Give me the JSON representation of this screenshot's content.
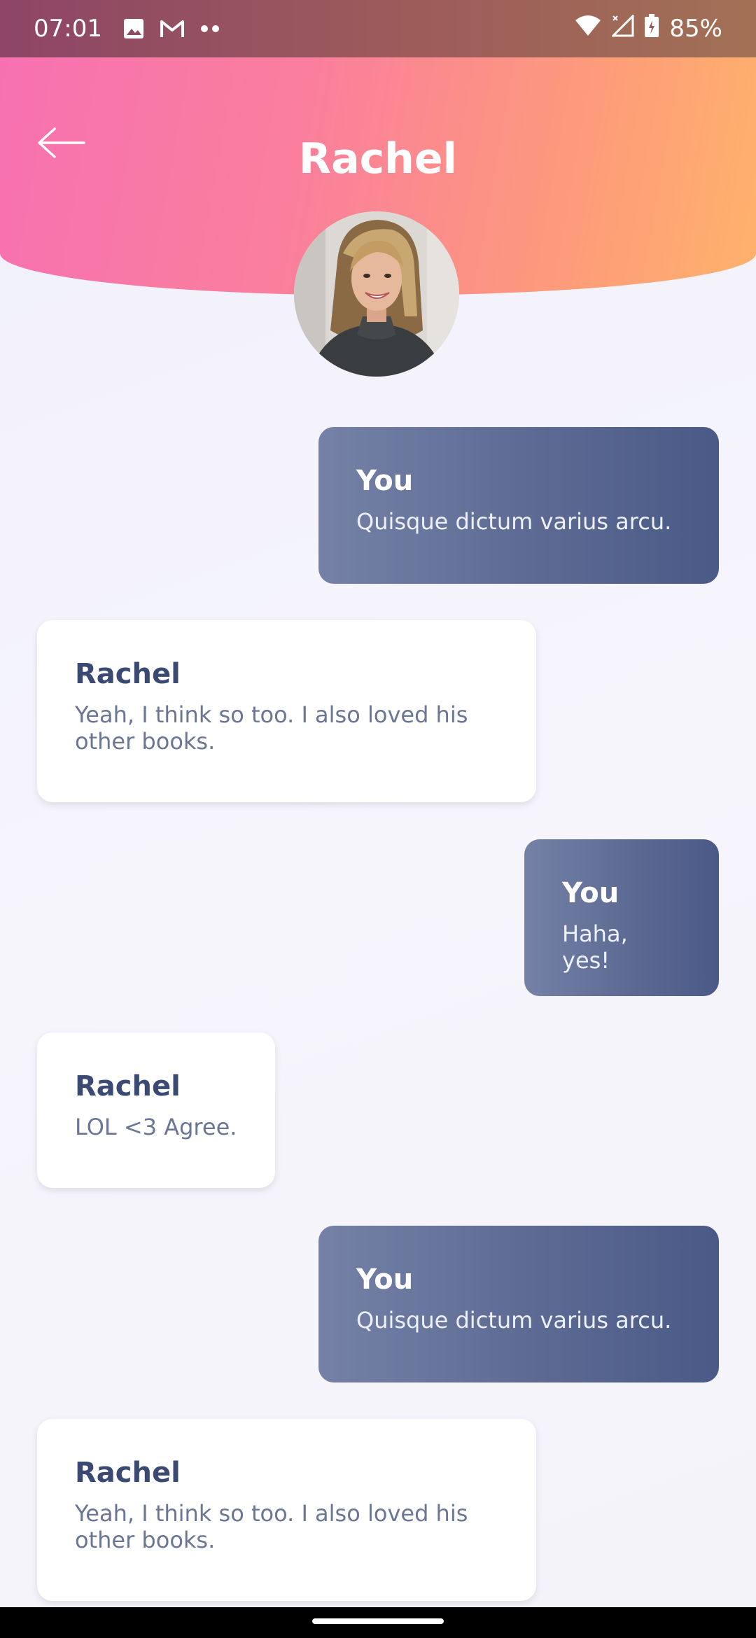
{
  "status_bar": {
    "time": "07:01",
    "battery": "85%",
    "icons": [
      "image-icon",
      "gmail-icon",
      "more-dots-icon",
      "wifi-icon",
      "signal-icon",
      "battery-icon"
    ]
  },
  "header": {
    "title": "Rachel",
    "back_icon": "arrow-left-icon",
    "gradient": [
      "#f771b1",
      "#ffb26b"
    ]
  },
  "colors": {
    "outgoing_bubble": "#5c6a93",
    "incoming_bubble": "#ffffff",
    "incoming_name": "#3b4a73"
  },
  "messages": [
    {
      "sender": "You",
      "text": "Quisque dictum varius arcu.",
      "direction": "outgoing"
    },
    {
      "sender": "Rachel",
      "text": "Yeah, I think so too. I also loved his other books.",
      "direction": "incoming"
    },
    {
      "sender": "You",
      "text": "Haha, yes!",
      "direction": "outgoing"
    },
    {
      "sender": "Rachel",
      "text": "LOL <3 Agree.",
      "direction": "incoming"
    },
    {
      "sender": "You",
      "text": "Quisque dictum varius arcu.",
      "direction": "outgoing"
    },
    {
      "sender": "Rachel",
      "text": "Yeah, I think so too. I also loved his other books.",
      "direction": "incoming"
    }
  ]
}
